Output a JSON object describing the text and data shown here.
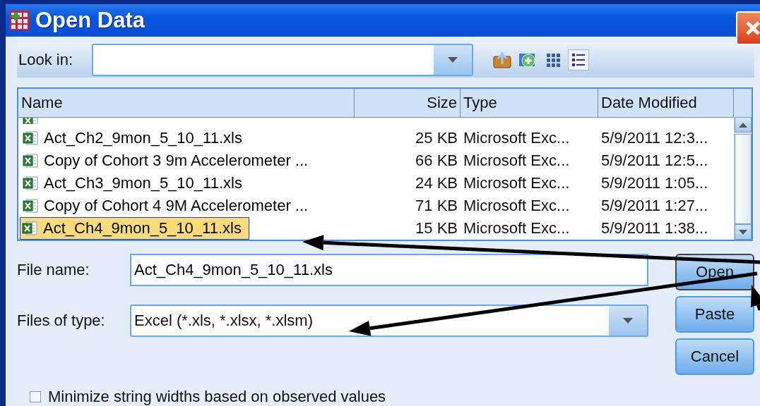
{
  "window": {
    "title": "Open Data"
  },
  "look_in": {
    "label": "Look in:"
  },
  "view_modes": [
    {
      "kind": "list",
      "selected": false
    },
    {
      "kind": "details",
      "selected": true
    }
  ],
  "file_list": {
    "columns": [
      "Name",
      "Size",
      "Type",
      "Date Modified"
    ],
    "rows": [
      {
        "name": "Act_Ch2_9mon_5_10_11.xls",
        "size": "25 KB",
        "type": "Microsoft Exc...",
        "date": "5/9/2011 12:3...",
        "selected": false
      },
      {
        "name": "Copy of Cohort 3 9m Accelerometer ...",
        "size": "66 KB",
        "type": "Microsoft Exc...",
        "date": "5/9/2011 12:5...",
        "selected": false
      },
      {
        "name": "Act_Ch3_9mon_5_10_11.xls",
        "size": "24 KB",
        "type": "Microsoft Exc...",
        "date": "5/9/2011 1:05...",
        "selected": false
      },
      {
        "name": "Copy of Cohort 4 9M Accelerometer ...",
        "size": "71 KB",
        "type": "Microsoft Exc...",
        "date": "5/9/2011 1:27...",
        "selected": false
      },
      {
        "name": "Act_Ch4_9mon_5_10_11.xls",
        "size": "15 KB",
        "type": "Microsoft Exc...",
        "date": "5/9/2011 1:38...",
        "selected": true
      }
    ]
  },
  "file_name": {
    "label": "File name:",
    "value": "Act_Ch4_9mon_5_10_11.xls"
  },
  "file_type": {
    "label": "Files of type:",
    "value": "Excel (*.xls, *.xlsx, *.xlsm)"
  },
  "buttons": [
    {
      "label": "Open",
      "default": true
    },
    {
      "label": "Paste",
      "default": false
    },
    {
      "label": "Cancel",
      "default": false
    }
  ],
  "options": [
    {
      "label": "Minimize string widths based on observed values",
      "checked": false
    }
  ]
}
